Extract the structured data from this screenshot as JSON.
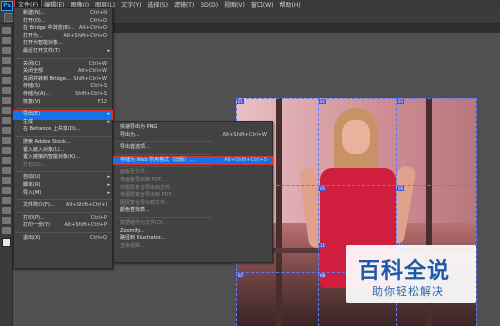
{
  "app": {
    "logo": "Ps"
  },
  "menubar": [
    {
      "label": "文件(F)",
      "active": true
    },
    {
      "label": "编辑(E)"
    },
    {
      "label": "图像(I)"
    },
    {
      "label": "图层(L)"
    },
    {
      "label": "文字(Y)"
    },
    {
      "label": "选择(S)"
    },
    {
      "label": "滤镜(T)"
    },
    {
      "label": "3D(D)"
    },
    {
      "label": "视图(V)"
    },
    {
      "label": "窗口(W)"
    },
    {
      "label": "帮助(H)"
    }
  ],
  "file_menu": [
    {
      "label": "新建(N)...",
      "shortcut": "Ctrl+N"
    },
    {
      "label": "打开(O)...",
      "shortcut": "Ctrl+O"
    },
    {
      "label": "在 Bridge 中浏览(B)...",
      "shortcut": "Alt+Ctrl+O"
    },
    {
      "label": "打开为...",
      "shortcut": "Alt+Shift+Ctrl+O"
    },
    {
      "label": "打开为智能对象..."
    },
    {
      "label": "最近打开文件(T)",
      "submenu": true
    },
    {
      "sep": true
    },
    {
      "label": "关闭(C)",
      "shortcut": "Ctrl+W"
    },
    {
      "label": "关闭全部",
      "shortcut": "Alt+Ctrl+W"
    },
    {
      "label": "关闭并转到 Bridge...",
      "shortcut": "Shift+Ctrl+W"
    },
    {
      "label": "存储(S)",
      "shortcut": "Ctrl+S"
    },
    {
      "label": "存储为(A)...",
      "shortcut": "Shift+Ctrl+S"
    },
    {
      "label": "恢复(V)",
      "shortcut": "F12"
    },
    {
      "sep": true
    },
    {
      "label": "导出(E)",
      "submenu": true,
      "highlight": true
    },
    {
      "label": "生成",
      "submenu": true
    },
    {
      "label": "在 Behance 上共享(D)..."
    },
    {
      "sep": true
    },
    {
      "label": "搜索 Adobe Stock..."
    },
    {
      "label": "置入嵌入对象(L)..."
    },
    {
      "label": "置入链接的智能对象(K)..."
    },
    {
      "label": "打包(G)...",
      "disabled": true
    },
    {
      "sep": true
    },
    {
      "label": "自动(U)",
      "submenu": true
    },
    {
      "label": "脚本(R)",
      "submenu": true
    },
    {
      "label": "导入(M)",
      "submenu": true
    },
    {
      "sep": true
    },
    {
      "label": "文件简介(F)...",
      "shortcut": "Alt+Shift+Ctrl+I"
    },
    {
      "sep": true
    },
    {
      "label": "打印(P)...",
      "shortcut": "Ctrl+P"
    },
    {
      "label": "打印一份(Y)",
      "shortcut": "Alt+Shift+Ctrl+P"
    },
    {
      "sep": true
    },
    {
      "label": "退出(X)",
      "shortcut": "Ctrl+Q"
    }
  ],
  "export_submenu": [
    {
      "label": "快速导出为 PNG"
    },
    {
      "label": "导出为...",
      "shortcut": "Alt+Shift+Ctrl+W"
    },
    {
      "sep": true
    },
    {
      "label": "导出首选项..."
    },
    {
      "sep": true
    },
    {
      "label": "存储为 Web 所用格式（旧版）...",
      "shortcut": "Alt+Shift+Ctrl+S",
      "highlight": true
    },
    {
      "sep": true
    },
    {
      "label": "画板至文件...",
      "disabled": true
    },
    {
      "label": "将画板导出到 PDF...",
      "disabled": true
    },
    {
      "label": "将图层复合导出到文件...",
      "disabled": true
    },
    {
      "label": "将图层复合导出到 PDF...",
      "disabled": true
    },
    {
      "label": "图层复合导出到文件...",
      "disabled": true
    },
    {
      "label": "颜色查找表..."
    },
    {
      "sep": true
    },
    {
      "label": "数据组作为文件(D)...",
      "disabled": true
    },
    {
      "label": "Zoomify..."
    },
    {
      "label": "路径到 Illustrator..."
    },
    {
      "label": "渲染视频...",
      "disabled": true
    }
  ],
  "slice_tags": [
    "01",
    "02",
    "03",
    "04",
    "05",
    "06",
    "07",
    "08",
    "09",
    "10",
    "11",
    "12"
  ],
  "watermark": {
    "title": "百科全说",
    "subtitle": "助你轻松解决"
  }
}
